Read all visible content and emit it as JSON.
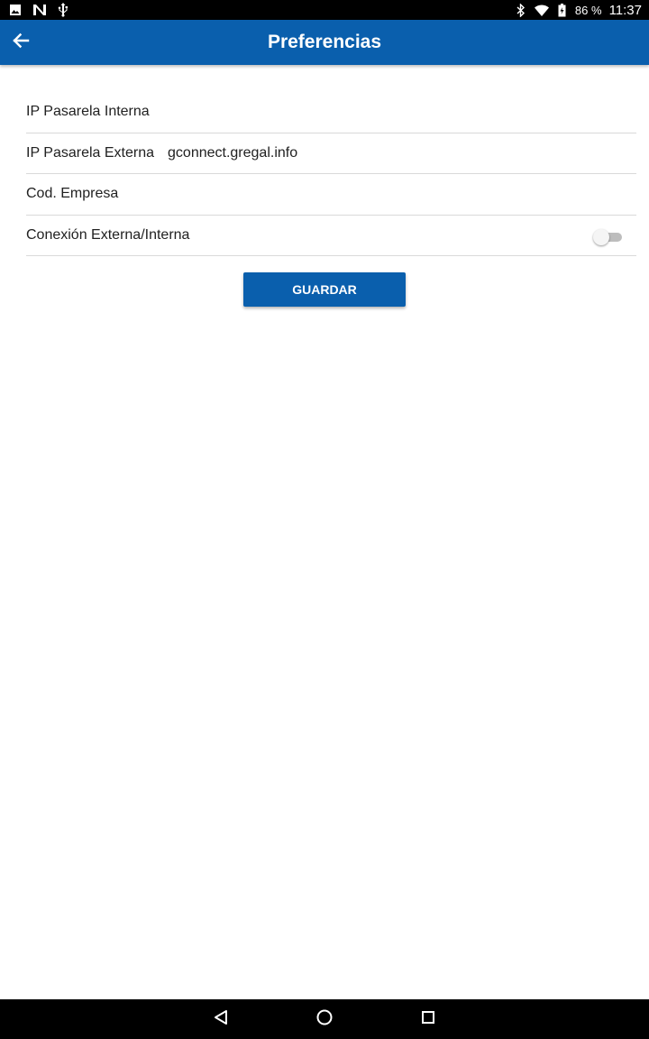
{
  "status_bar": {
    "icons_left": [
      "image-icon",
      "n-icon",
      "usb-icon"
    ],
    "icons_right": [
      "bluetooth-icon",
      "wifi-icon",
      "battery-icon"
    ],
    "battery": "86 %",
    "time": "11:37"
  },
  "app_bar": {
    "title": "Preferencias",
    "back_icon": "arrow-back-icon",
    "color": "#0a5fad"
  },
  "form": {
    "fields": [
      {
        "label": "IP Pasarela Interna",
        "value": ""
      },
      {
        "label": "IP Pasarela Externa",
        "value": "gconnect.gregal.info"
      },
      {
        "label": "Cod. Empresa",
        "value": ""
      }
    ],
    "toggle": {
      "label": "Conexión Externa/Interna",
      "checked": false
    }
  },
  "save_button": {
    "label": "GUARDAR"
  },
  "nav_bar": {
    "icons": [
      "back-triangle-icon",
      "home-circle-icon",
      "recents-square-icon"
    ]
  }
}
